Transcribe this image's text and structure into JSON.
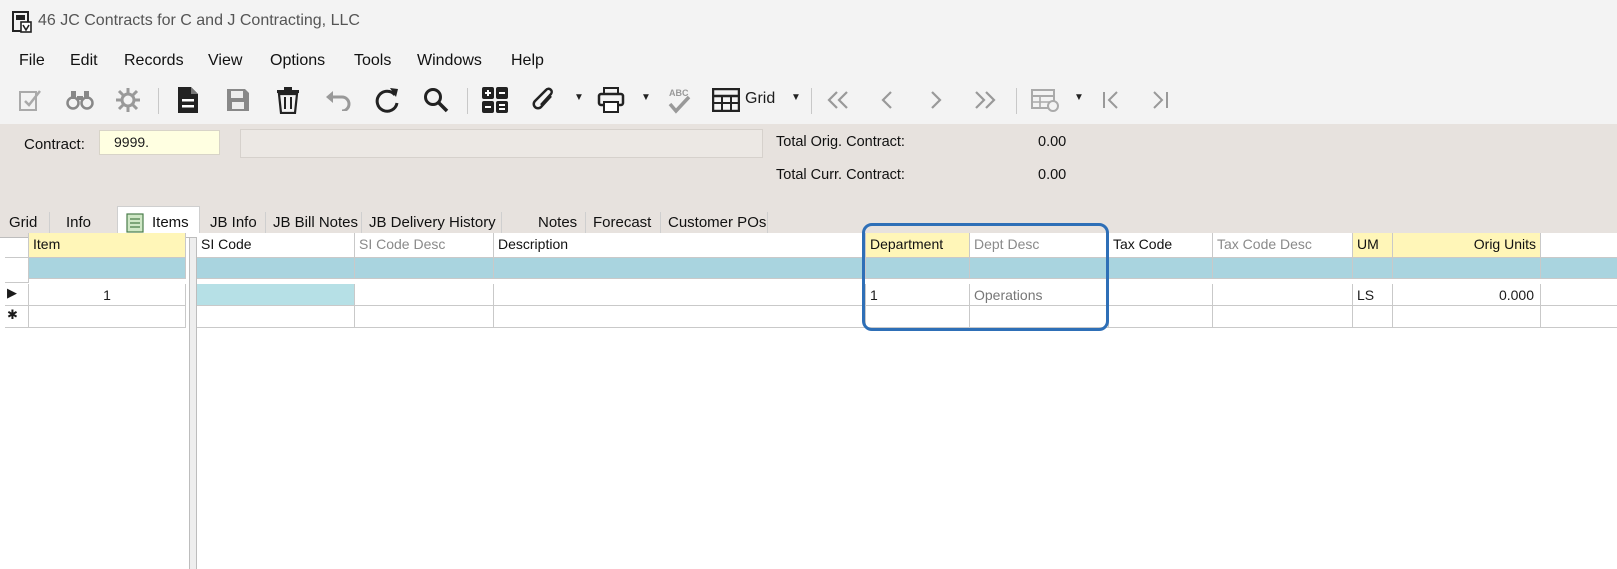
{
  "window": {
    "title": "46 JC Contracts for C and J Contracting, LLC"
  },
  "menu": [
    "File",
    "Edit",
    "Records",
    "View",
    "Options",
    "Tools",
    "Windows",
    "Help"
  ],
  "toolbar": {
    "grid_label": "Grid"
  },
  "header": {
    "contract_label": "Contract:",
    "contract_value": "9999.",
    "contract_desc": "",
    "total_orig_label": "Total Orig. Contract:",
    "total_orig_value": "0.00",
    "total_curr_label": "Total Curr. Contract:",
    "total_curr_value": "0.00"
  },
  "tabs": [
    "Grid",
    "Info",
    "Items",
    "JB Info",
    "JB Bill Notes",
    "JB Delivery History",
    "Notes",
    "Forecast",
    "Customer POs"
  ],
  "grid": {
    "columns": [
      "Item",
      "SI Code",
      "SI Code Desc",
      "Description",
      "Department",
      "Dept Desc",
      "Tax Code",
      "Tax Code Desc",
      "UM",
      "Orig Units"
    ],
    "rows": [
      {
        "item": "1",
        "si_code": "",
        "si_code_desc": "",
        "description": "",
        "department": "1",
        "dept_desc": "Operations",
        "tax_code": "",
        "tax_code_desc": "",
        "um": "LS",
        "orig_units": "0.000"
      }
    ],
    "new_row_marker": "✱",
    "current_row_marker": "▶"
  },
  "colors": {
    "highlight": "#2e6fb7",
    "required_header": "#fff6b8",
    "filter_row": "#a9d4df",
    "header_bg": "#e7e2de"
  }
}
